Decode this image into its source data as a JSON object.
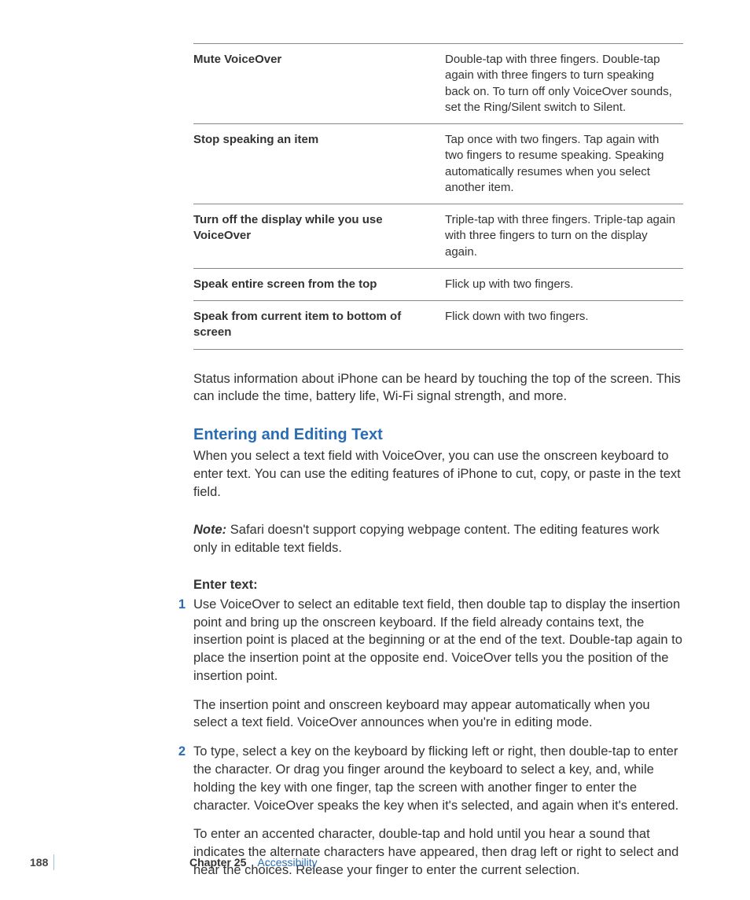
{
  "table_rows": [
    {
      "left": "Mute VoiceOver",
      "right": "Double-tap with three fingers. Double-tap again with three fingers to turn speaking back on. To turn off only VoiceOver sounds, set the Ring/Silent switch to Silent."
    },
    {
      "left": "Stop speaking an item",
      "right": "Tap once with two fingers. Tap again with two fingers to resume speaking. Speaking automatically resumes when you select another item."
    },
    {
      "left": "Turn off the display while you use VoiceOver",
      "right": "Triple-tap with three fingers. Triple-tap again with three fingers to turn on the display again."
    },
    {
      "left": "Speak entire screen from the top",
      "right": "Flick up with two fingers."
    },
    {
      "left": "Speak from current item to bottom of screen",
      "right": "Flick down with two fingers."
    }
  ],
  "para_status": "Status information about iPhone can be heard by touching the top of the screen. This can include the time, battery life, Wi-Fi signal strength, and more.",
  "section_heading": "Entering and Editing Text",
  "para_editing_intro": "When you select a text field with VoiceOver, you can use the onscreen keyboard to enter text. You can use the editing features of iPhone to cut, copy, or paste in the text field.",
  "note_label": "Note:",
  "note_body": "  Safari doesn't support copying webpage content. The editing features work only in editable text fields.",
  "enter_text_label": "Enter text:",
  "steps": [
    {
      "num": "1",
      "text": "Use VoiceOver to select an editable text field, then double tap to display the insertion point and bring up the onscreen keyboard. If the field already contains text, the insertion point is placed at the beginning or at the end of the text. Double-tap again to place the insertion point at the opposite end. VoiceOver tells you the position of the insertion point.",
      "cont": "The insertion point and onscreen keyboard may appear automatically when you select a text field. VoiceOver announces when you're in editing mode."
    },
    {
      "num": "2",
      "text": "To type, select a key on the keyboard by flicking left or right, then double-tap to enter the character. Or drag you finger around the keyboard to select a key, and, while holding the key with one finger, tap the screen with another finger to enter the character. VoiceOver speaks the key when it's selected, and again when it's entered.",
      "cont": "To enter an accented character, double-tap and hold until you hear a sound that indicates the alternate characters have appeared, then drag left or right to select and hear the choices. Release your finger to enter the current selection."
    }
  ],
  "footer": {
    "page": "188",
    "chapter_label": "Chapter 25",
    "chapter_title": "Accessibility"
  }
}
